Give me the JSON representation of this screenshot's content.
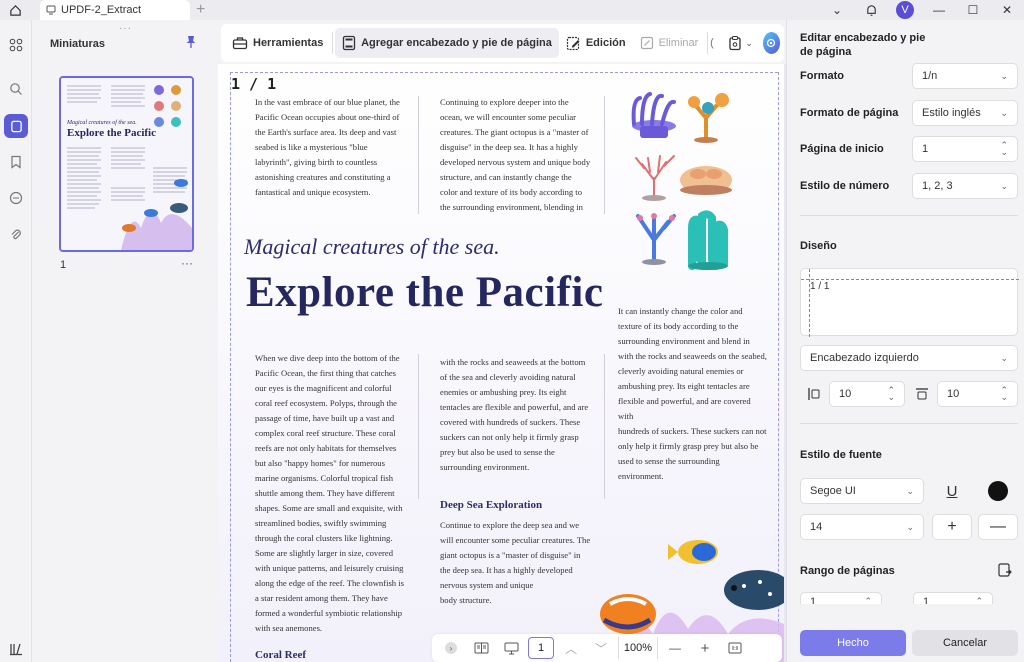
{
  "tab": {
    "title": "UPDF-2_Extract"
  },
  "user": {
    "avatar_initial": "V"
  },
  "thumbnails": {
    "title": "Miniaturas",
    "page_number": "1",
    "more": "···",
    "mini_subtitle": "Magical creatures of the sea.",
    "mini_title": "Explore the Pacific"
  },
  "toolbar": {
    "tools": "Herramientas",
    "add_header_footer": "Agregar encabezado y pie de página",
    "edit": "Edición",
    "delete": "Eliminar"
  },
  "document": {
    "header_number": "1 / 1",
    "subtitle": "Magical creatures of the sea.",
    "title": "Explore the Pacific",
    "col1_top": [
      "In the vast embrace of our blue planet, the",
      "Pacific Ocean occupies about one-third of",
      "the Earth's surface area. Its deep and vast",
      "seabed is like a mysterious \"blue",
      "labyrinth\", giving birth to countless",
      "astonishing creatures and constituting a",
      "fantastical and unique ecosystem."
    ],
    "col2_top": [
      "Continuing to explore deeper into the",
      "ocean, we will encounter some peculiar",
      "creatures. The giant octopus is a \"master of",
      "disguise\" in the deep sea. It has a highly",
      "developed nervous system and unique body",
      "structure, and can instantly change the",
      "color and texture of its body according to",
      "the surrounding environment, blending in"
    ],
    "col3_mid": [
      "It can instantly change the color and",
      "texture of its body according to the",
      "surrounding environment and blend in",
      "with the rocks and seaweeds on the seabed,",
      "cleverly avoiding natural enemies or",
      "ambushing prey. Its eight tentacles are",
      "flexible and powerful, and are covered with",
      "hundreds of suckers. These suckers can not",
      "only help it firmly grasp prey but also be",
      "used to sense the surrounding",
      "environment."
    ],
    "col1_bottom": [
      "When we dive deep into the bottom of the",
      "Pacific Ocean, the first thing that catches",
      "our eyes is the magnificent and colorful",
      "coral reef ecosystem. Polyps, through the",
      "passage of time, have built up a vast and",
      "complex coral reef structure. These coral",
      "reefs are not only habitats for themselves",
      "but also \"happy homes\" for numerous",
      "marine organisms. Colorful tropical fish",
      "shuttle among them. They have different",
      "shapes. Some are small and exquisite, with",
      "streamlined bodies, swiftly swimming",
      "through the coral clusters like lightning.",
      "Some are slightly larger in size, covered",
      "with unique patterns, and leisurely cruising",
      "along the edge of the reef. The clownfish is",
      "a star resident among them. They have",
      "formed a wonderful symbiotic relationship",
      "with sea anemones."
    ],
    "col2_bottom": [
      "with the rocks and seaweeds at the bottom",
      "of the sea and cleverly avoiding natural",
      "enemies or ambushing prey. Its eight",
      "tentacles are flexible and powerful, and are",
      "covered with hundreds of suckers. These",
      "suckers can not only help it firmly grasp",
      "prey but also be used to sense the",
      "surrounding environment."
    ],
    "deep_sea_heading": "Deep Sea Exploration",
    "col2_deep": [
      "Continue to explore the deep sea and we",
      "will encounter some peculiar creatures. The",
      "giant octopus is a \"master of disguise\" in",
      "the deep sea. It has a highly developed",
      "nervous system and unique",
      "body structure."
    ],
    "coral_reef_heading": "Coral Reef"
  },
  "zoombar": {
    "page": "1",
    "zoom": "100%"
  },
  "panel": {
    "title": "Editar encabezado y pie de página",
    "format_label": "Formato",
    "format_value": "1/n",
    "page_format_label": "Formato de página",
    "page_format_value": "Estilo inglés",
    "start_page_label": "Página de inicio",
    "start_page_value": "1",
    "number_style_label": "Estilo de número",
    "number_style_value": "1, 2, 3",
    "design_label": "Diseño",
    "preview_text": "1 / 1",
    "position_value": "Encabezado izquierdo",
    "margin_left_value": "10",
    "margin_top_value": "10",
    "font_style_label": "Estilo de fuente",
    "font_value": "Segoe UI",
    "font_size_value": "14",
    "font_color": "#111111",
    "page_range_label": "Rango de páginas",
    "range_from": "1",
    "range_to": "1",
    "done": "Hecho",
    "cancel": "Cancelar"
  },
  "colors": {
    "accent": "#5b5bd6",
    "title_navy": "#25275f",
    "done_button": "#7b7bea"
  }
}
